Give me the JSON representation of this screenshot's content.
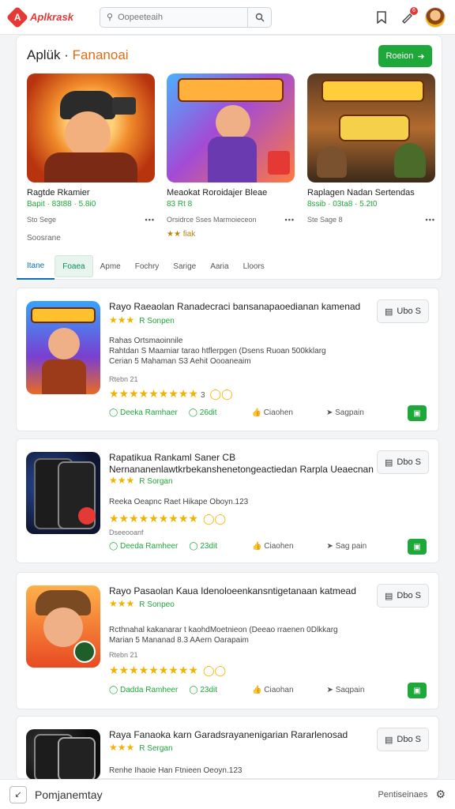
{
  "header": {
    "logo_text": "Aplkrask",
    "logo_mark": "A",
    "search_placeholder": "Oopeeteaih",
    "search_icon": "search-icon",
    "notification_count": "6"
  },
  "featured": {
    "title_main": "Aplük ·",
    "title_accent": "Fananoai",
    "button_label": "Roeion",
    "subtitle": "Soosrane",
    "games": [
      {
        "name": "Ragtde Rkamier",
        "price": "Bapit · 83t88 · 5.8i0",
        "meta": "Sto Sege",
        "extra": ""
      },
      {
        "name": "Meaokat Roroidajer Bleae",
        "price": "83 Rt 8",
        "meta": "Orsidrce Sses Marmoieceon",
        "extra": "★★ fiak"
      },
      {
        "name": "Raplagen Nadan Sertendas",
        "price": "8ssib · 03ta8 · 5.2t0",
        "meta": "Ste Sage 8",
        "extra": ""
      }
    ],
    "tabs": [
      "Itane",
      "Foaea",
      "Apme",
      "Fochry",
      "Sarige",
      "Aaria",
      "Lloors"
    ]
  },
  "apps": [
    {
      "title": "Rayo Raeaolan Ranadecraci bansanapaoedianan kamenad",
      "rating_label": "R Sonpen",
      "desc": [
        "Rahas Ortsmaoinnile",
        "Rahtdan S Maamiar tarao htflerpgen (Dsens Ruoan 500kklarg",
        "Cerian 5 Mahaman S3 Aehit Oooaneaim"
      ],
      "small": "Rtebn 21",
      "stars_count": "3",
      "foot": [
        "Deeka Ramhaer",
        "26dit",
        "Ciaohen",
        "Sagpain"
      ],
      "dl_label": "Ubo S"
    },
    {
      "title": "Rapatikua Rankaml Saner CB Nernananenlawtkrbekanshenetongeactiedan Rarpla Ueaecnan",
      "rating_label": "R Sorgan",
      "desc": [
        "Reeka Oeapnc Raet Hikape Oboyn.123"
      ],
      "small": "Dseeooanf",
      "stars_count": "",
      "foot": [
        "Deeda Ramheer",
        "23dit",
        "Ciaohen",
        "Sag pain"
      ],
      "dl_label": "Dbo S"
    },
    {
      "title": "Rayo Pasaolan Kaua Idenoloeenkansntigetanaan katmead",
      "rating_label": "R Sonpeo",
      "desc": [
        "Rcthnahal kakanarar t kaohdMoetnieon (Deeao rraenen 0Dlkkarg",
        "Marian 5 Mananad 8.3 AAern Oarapaim"
      ],
      "small": "Rtebn 21",
      "stars_count": "",
      "foot": [
        "Dadda Ramheer",
        "23dit",
        "Ciaohan",
        "Saqpain"
      ],
      "dl_label": "Dbo S"
    },
    {
      "title": "Raya Fanaoka karn Garadsrayanenigarian Rararlenosad",
      "rating_label": "R Sergan",
      "desc": [
        "Renhe Ihaoie Han Ftnieen Oeoyn.123"
      ],
      "small": "",
      "stars_count": "",
      "foot": [],
      "dl_label": "Dbo S"
    }
  ],
  "bottombar": {
    "left_text": "Pomjanemtay",
    "right_text": "Pentiseinaes"
  },
  "colors": {
    "brand": "#e53935",
    "accent_green": "#1fa83a",
    "tab_active": "#0b6fb8",
    "star": "#f0b400"
  }
}
